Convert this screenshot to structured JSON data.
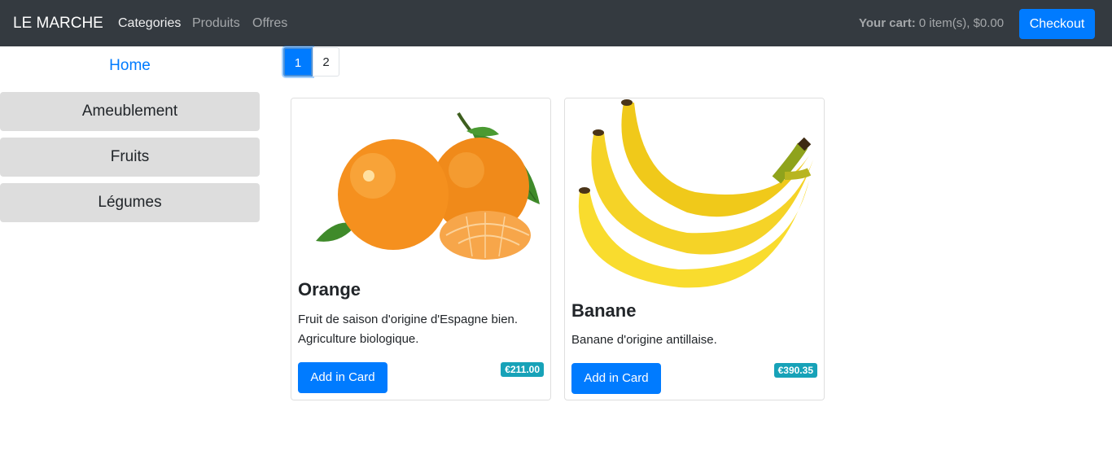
{
  "navbar": {
    "brand": "LE MARCHE",
    "links": [
      "Categories",
      "Produits",
      "Offres"
    ],
    "cart_label": "Your cart:",
    "cart_value": "0 item(s), $0.00",
    "checkout_label": "Checkout"
  },
  "sidebar": {
    "home": "Home",
    "categories": [
      "Ameublement",
      "Fruits",
      "Légumes"
    ]
  },
  "pagination": {
    "pages": [
      "1",
      "2"
    ],
    "current": "1"
  },
  "products": [
    {
      "title": "Orange",
      "description": "Fruit de saison d'origine d'Espagne bien. Agriculture biologique.",
      "button": "Add in Card",
      "price": "€211.00",
      "image_icon": "orange-fruit-image"
    },
    {
      "title": "Banane",
      "description": "Banane d'origine antillaise.",
      "button": "Add in Card",
      "price": "€390.35",
      "image_icon": "banana-fruit-image"
    }
  ],
  "colors": {
    "navbar_bg": "#343a40",
    "primary": "#007bff",
    "badge": "#17a2b8",
    "category_bg": "#dddddd"
  }
}
